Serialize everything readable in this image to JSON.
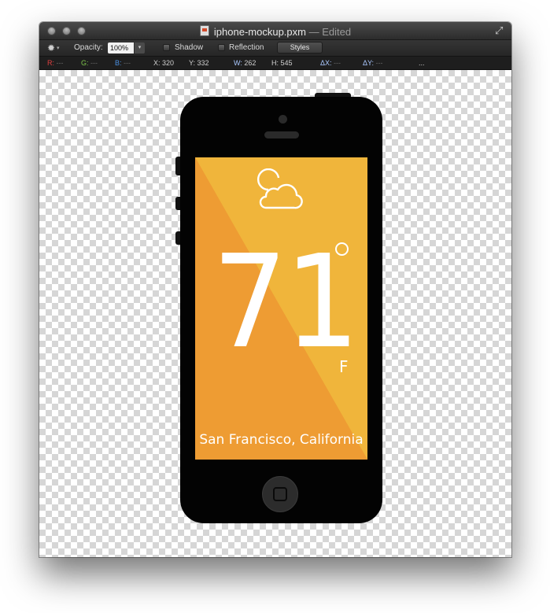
{
  "window": {
    "title": "iphone-mockup.pxm",
    "title_separator": "—",
    "title_status": "Edited"
  },
  "toolbar": {
    "opacity_label": "Opacity:",
    "opacity_value": "100%",
    "shadow_label": "Shadow",
    "reflection_label": "Reflection",
    "styles_label": "Styles"
  },
  "infobar": {
    "r_label": "R:",
    "g_label": "G:",
    "b_label": "B:",
    "empty_value": "---",
    "x_label": "X:",
    "x_value": "320",
    "y_label": "Y:",
    "y_value": "332",
    "w_label": "W:",
    "w_value": "262",
    "h_label": "H:",
    "h_value": "545",
    "dx_label": "ΔX:",
    "dy_label": "ΔY:",
    "more": "..."
  },
  "weather": {
    "temperature": "71",
    "unit": "F",
    "location": "San Francisco, California",
    "icon": "partly-cloudy-icon"
  },
  "colors": {
    "screen_light": "#f0b53b",
    "screen_dark": "#ee9c33",
    "phone_body": "#030303"
  }
}
